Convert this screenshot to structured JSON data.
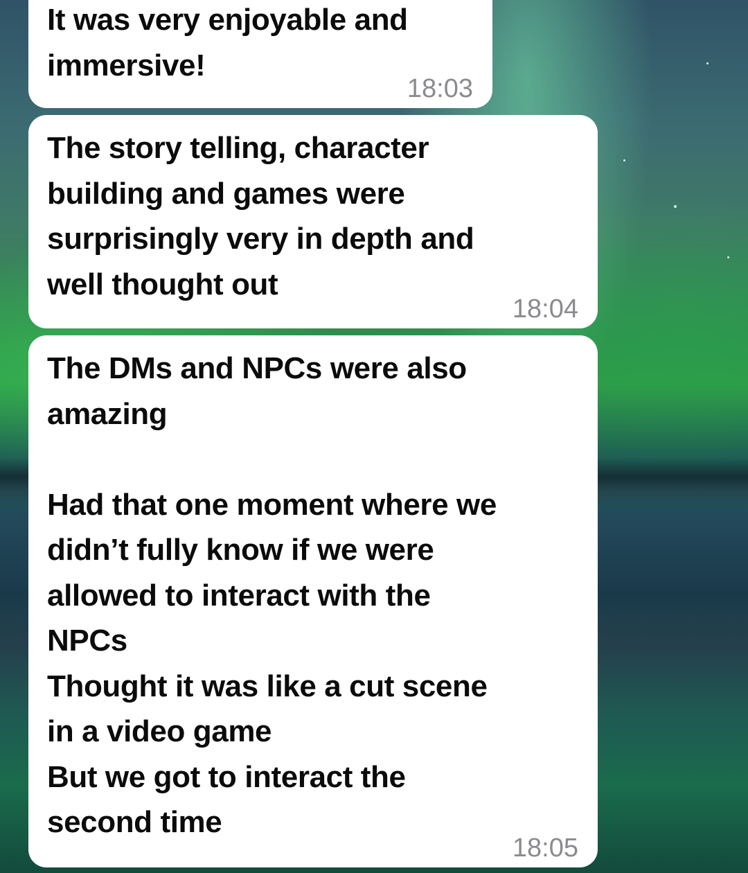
{
  "background": {
    "theme": "aurora-night-lake",
    "colors": {
      "aurora_green": "#2e9a47",
      "sky": "#2f5366",
      "water": "#134a3c"
    }
  },
  "messages": [
    {
      "text": "It was very enjoyable and\nimmersive!",
      "time": "18:03"
    },
    {
      "text": "The story telling, character\nbuilding and games were\nsurprisingly very in depth and\nwell thought out",
      "time": "18:04"
    },
    {
      "text": "The DMs and NPCs were also\namazing\n\nHad that one moment where we\ndidn’t fully know if we were\nallowed to interact with the\nNPCs\nThought it was like a cut scene\nin a video game\nBut we got to interact the\nsecond time",
      "time": "18:05"
    }
  ]
}
